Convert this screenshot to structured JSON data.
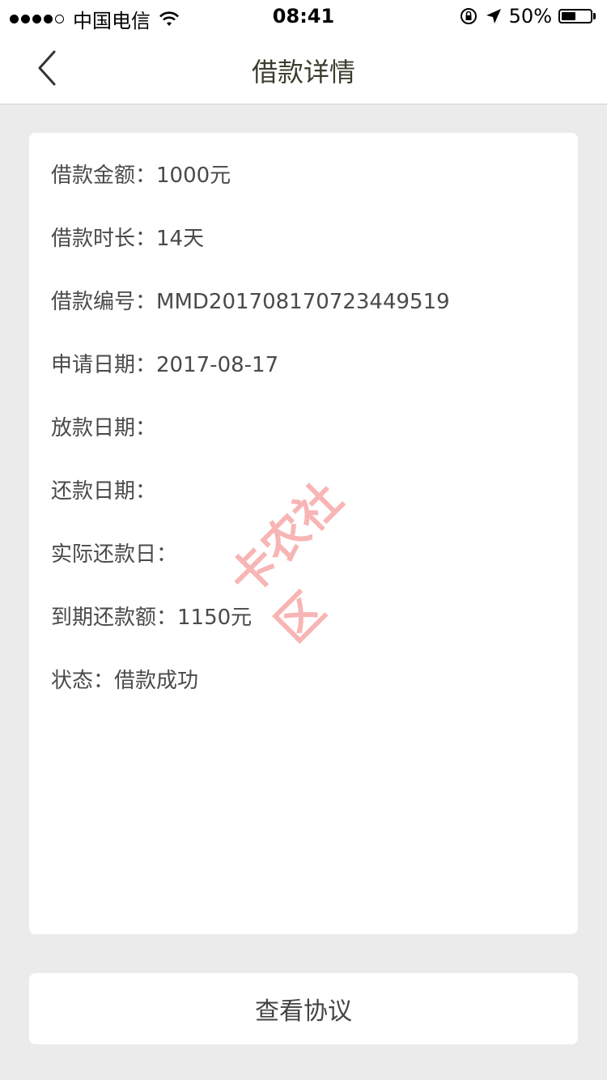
{
  "status_bar": {
    "carrier": "中国电信",
    "time": "08:41",
    "battery_percent": "50%",
    "battery_level": 0.5
  },
  "nav": {
    "title": "借款详情",
    "back_icon": "chevron-left-icon"
  },
  "details": [
    {
      "label": "借款金额：",
      "value": "1000元"
    },
    {
      "label": "借款时长：",
      "value": "14天"
    },
    {
      "label": "借款编号：",
      "value": "MMD201708170723449519"
    },
    {
      "label": "申请日期：",
      "value": "2017-08-17"
    },
    {
      "label": "放款日期：",
      "value": ""
    },
    {
      "label": "还款日期：",
      "value": ""
    },
    {
      "label": "实际还款日：",
      "value": ""
    },
    {
      "label": "到期还款额：",
      "value": "1150元"
    },
    {
      "label": "状态：",
      "value": "借款成功"
    }
  ],
  "watermark": {
    "text": "卡农社区"
  },
  "agreement_button": {
    "label": "查看协议"
  }
}
